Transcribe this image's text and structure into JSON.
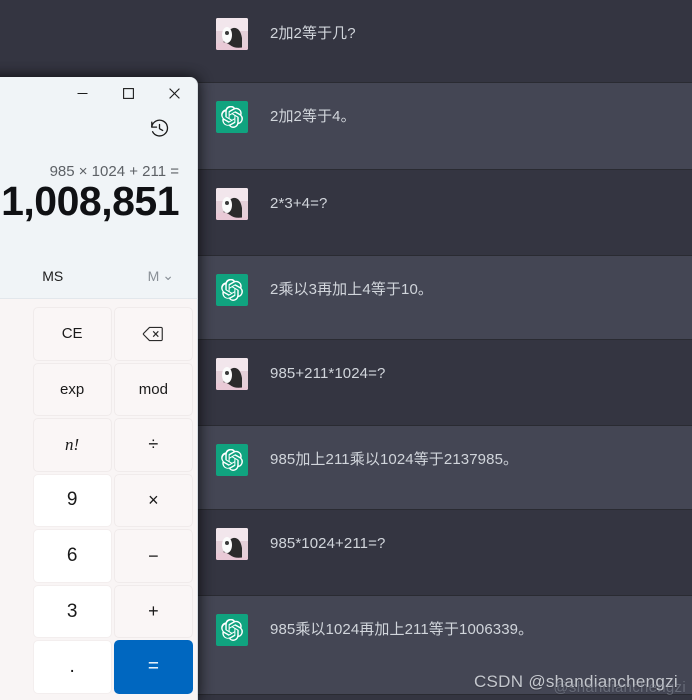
{
  "chat": {
    "app_name": "ChatGPT",
    "messages": [
      {
        "role": "user",
        "avatar": "user-photo-avatar",
        "text": "2加2等于几?"
      },
      {
        "role": "assistant",
        "avatar": "openai-logo-avatar",
        "text": "2加2等于4。"
      },
      {
        "role": "user",
        "avatar": "user-photo-avatar",
        "text": "2*3+4=?"
      },
      {
        "role": "assistant",
        "avatar": "openai-logo-avatar",
        "text": "2乘以3再加上4等于10。"
      },
      {
        "role": "user",
        "avatar": "user-photo-avatar",
        "text": "985+211*1024=?"
      },
      {
        "role": "assistant",
        "avatar": "openai-logo-avatar",
        "text": "985加上211乘以1024等于2137985。"
      },
      {
        "role": "user",
        "avatar": "user-photo-avatar",
        "text": "985*1024+211=?"
      },
      {
        "role": "assistant",
        "avatar": "openai-logo-avatar",
        "text": "985乘以1024再加上211等于1006339。"
      }
    ],
    "colors": {
      "user_row_bg": "#343541",
      "assistant_row_bg": "#444654",
      "assistant_avatar_bg": "#10a37f",
      "text": "#d1d5db"
    }
  },
  "watermark": {
    "text": "CSDN @shandianchengzi",
    "ghost_text": "@shandianchengzi"
  },
  "calculator": {
    "titlebar": {
      "minimize_label": "minimize",
      "maximize_label": "maximize",
      "close_label": "close"
    },
    "history_button_label": "history",
    "display": {
      "expression": "985 × 1024 + 211 =",
      "result": "1,008,851"
    },
    "memory": {
      "ms_label": "MS",
      "open_label": "M",
      "chevron": "⌄"
    },
    "keys": [
      {
        "label": "CE",
        "type": "fn",
        "name": "key-clear-entry"
      },
      {
        "label": "",
        "type": "fn",
        "name": "key-backspace",
        "icon": "backspace-icon"
      },
      {
        "label": "exp",
        "type": "fn",
        "name": "key-exp"
      },
      {
        "label": "mod",
        "type": "fn",
        "name": "key-mod"
      },
      {
        "label": "n!",
        "type": "fn italic",
        "name": "key-factorial"
      },
      {
        "label": "÷",
        "type": "op",
        "name": "key-divide"
      },
      {
        "label": "9",
        "type": "num",
        "name": "key-9"
      },
      {
        "label": "×",
        "type": "op",
        "name": "key-multiply"
      },
      {
        "label": "6",
        "type": "num",
        "name": "key-6"
      },
      {
        "label": "−",
        "type": "op",
        "name": "key-subtract"
      },
      {
        "label": "3",
        "type": "num",
        "name": "key-3"
      },
      {
        "label": "+",
        "type": "op",
        "name": "key-add"
      },
      {
        "label": ".",
        "type": "num",
        "name": "key-decimal"
      },
      {
        "label": "=",
        "type": "equals",
        "name": "key-equals"
      }
    ],
    "accent_color": "#0067c0",
    "window_bg": "#f0f4f7",
    "keypad_bg": "#f9f5f5"
  }
}
